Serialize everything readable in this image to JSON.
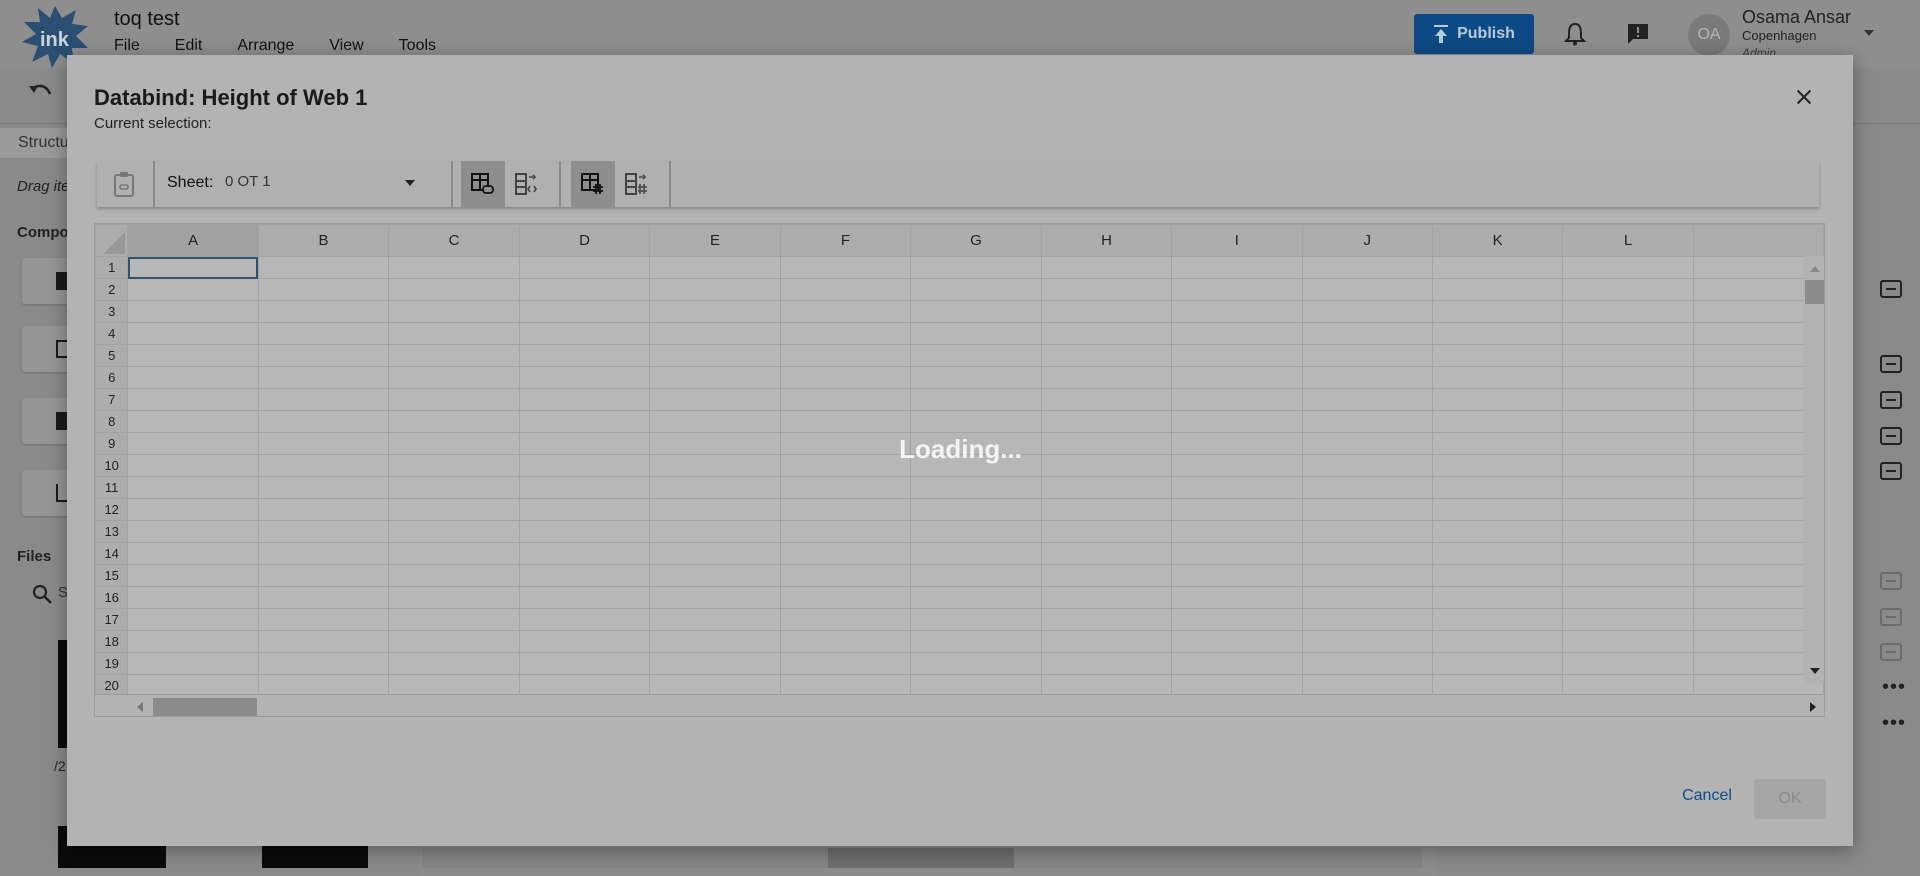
{
  "app": {
    "doc_title": "toq test",
    "menu": [
      "File",
      "Edit",
      "Arrange",
      "View",
      "Tools"
    ],
    "publish_label": "Publish",
    "user": {
      "initials": "OA",
      "name": "Osama Ansar",
      "city": "Copenhagen",
      "role": "Admin"
    },
    "structure_tab": "Structu",
    "drag_hint": "Drag ite",
    "components_label": "Compo",
    "files_label": "Files",
    "files_search_placeholder": "S",
    "thumb_caption": "/2"
  },
  "dialog": {
    "title": "Databind: Height of Web 1",
    "subtitle": "Current selection:",
    "sheet_label": "Sheet:",
    "sheet_value": "0 OT 1",
    "columns": [
      "A",
      "B",
      "C",
      "D",
      "E",
      "F",
      "G",
      "H",
      "I",
      "J",
      "K",
      "L"
    ],
    "rows": [
      "1",
      "2",
      "3",
      "4",
      "5",
      "6",
      "7",
      "8",
      "9",
      "10",
      "11",
      "12",
      "13",
      "14",
      "15",
      "16",
      "17",
      "18",
      "19",
      "20"
    ],
    "active_cell": "A1",
    "loading_text": "Loading...",
    "cancel_label": "Cancel",
    "ok_label": "OK"
  },
  "colors": {
    "accent": "#0d4a85",
    "link": "#0c4d8c"
  },
  "icons": [
    "ink-logo-icon",
    "upload-icon",
    "bell-icon",
    "feedback-icon",
    "undo-icon",
    "search-icon",
    "clipboard-link-icon",
    "table-link-icon",
    "table-code-icon",
    "table-hash-icon",
    "columns-hash-icon",
    "link-icon",
    "more-icon",
    "close-icon"
  ]
}
